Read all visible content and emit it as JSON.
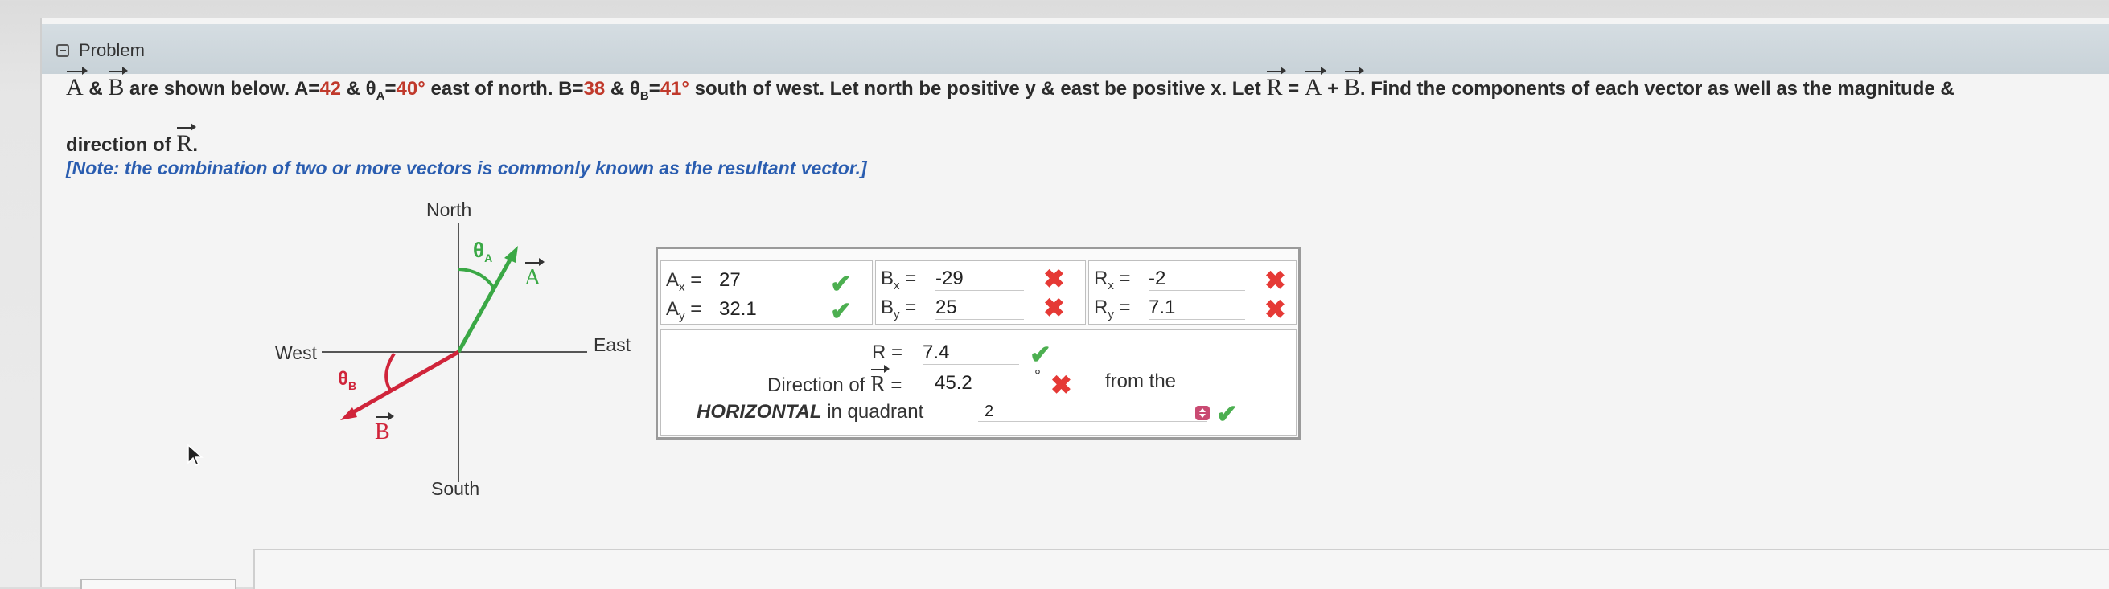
{
  "problem": {
    "section_label": "Problem",
    "line1_a": "A",
    "line1_amp": " & ",
    "line1_b": "B",
    "line1_text1": " are shown below. A=",
    "A_mag": "42",
    "line1_text2": " & θ",
    "A_sub": "A",
    "line1_eq": "=",
    "A_angle": "40°",
    "line1_text3": " east of north. B=",
    "B_mag": "38",
    "line1_text4": " & θ",
    "B_sub": "B",
    "line1_eq2": "=",
    "B_angle": "41°",
    "line1_text5": " south of west. Let north be positive y & east be positive x. Let ",
    "R_sym": "R",
    "eq_text": " = ",
    "A_sym": "A",
    "plus": " + ",
    "B_sym": "B",
    "line1_text6": ". Find the components of each vector as well as the magnitude &",
    "line2_text": "direction of ",
    "line2_R": "R",
    "line2_end": ".",
    "note": "[Note: the combination of two or more vectors is commonly known as the resultant vector.]"
  },
  "diagram": {
    "north": "North",
    "south": "South",
    "east": "East",
    "west": "West",
    "theta_a": "θA",
    "theta_b": "θB",
    "vec_a": "A",
    "vec_b": "B",
    "colors": {
      "a": "#3aa845",
      "b": "#d0243a",
      "axis": "#555555"
    }
  },
  "answers": {
    "ax_label": "A",
    "ax_sub": "x",
    "ax_value": "27",
    "ay_label": "A",
    "ay_sub": "y",
    "ay_value": "32.1",
    "bx_label": "B",
    "bx_sub": "x",
    "bx_value": "-29",
    "by_label": "B",
    "by_sub": "y",
    "by_value": "25",
    "rx_label": "R",
    "rx_sub": "x",
    "rx_value": "-2",
    "ry_label": "R",
    "ry_sub": "y",
    "ry_value": "7.1",
    "equals": "=",
    "r_label": "R =",
    "r_value": "7.4",
    "dir_label": "Direction of ",
    "dir_R": "R",
    "dir_eq": " =",
    "dir_value": "45.2",
    "degree": "°",
    "from_the": "from the",
    "horizontal": "HORIZONTAL",
    "in_quadrant": " in quadrant",
    "quadrant_value": "2",
    "status": {
      "ax": "correct",
      "ay": "correct",
      "bx": "incorrect",
      "by": "incorrect",
      "rx": "incorrect",
      "ry": "incorrect",
      "r": "correct",
      "dir": "incorrect",
      "quadrant": "correct"
    }
  }
}
